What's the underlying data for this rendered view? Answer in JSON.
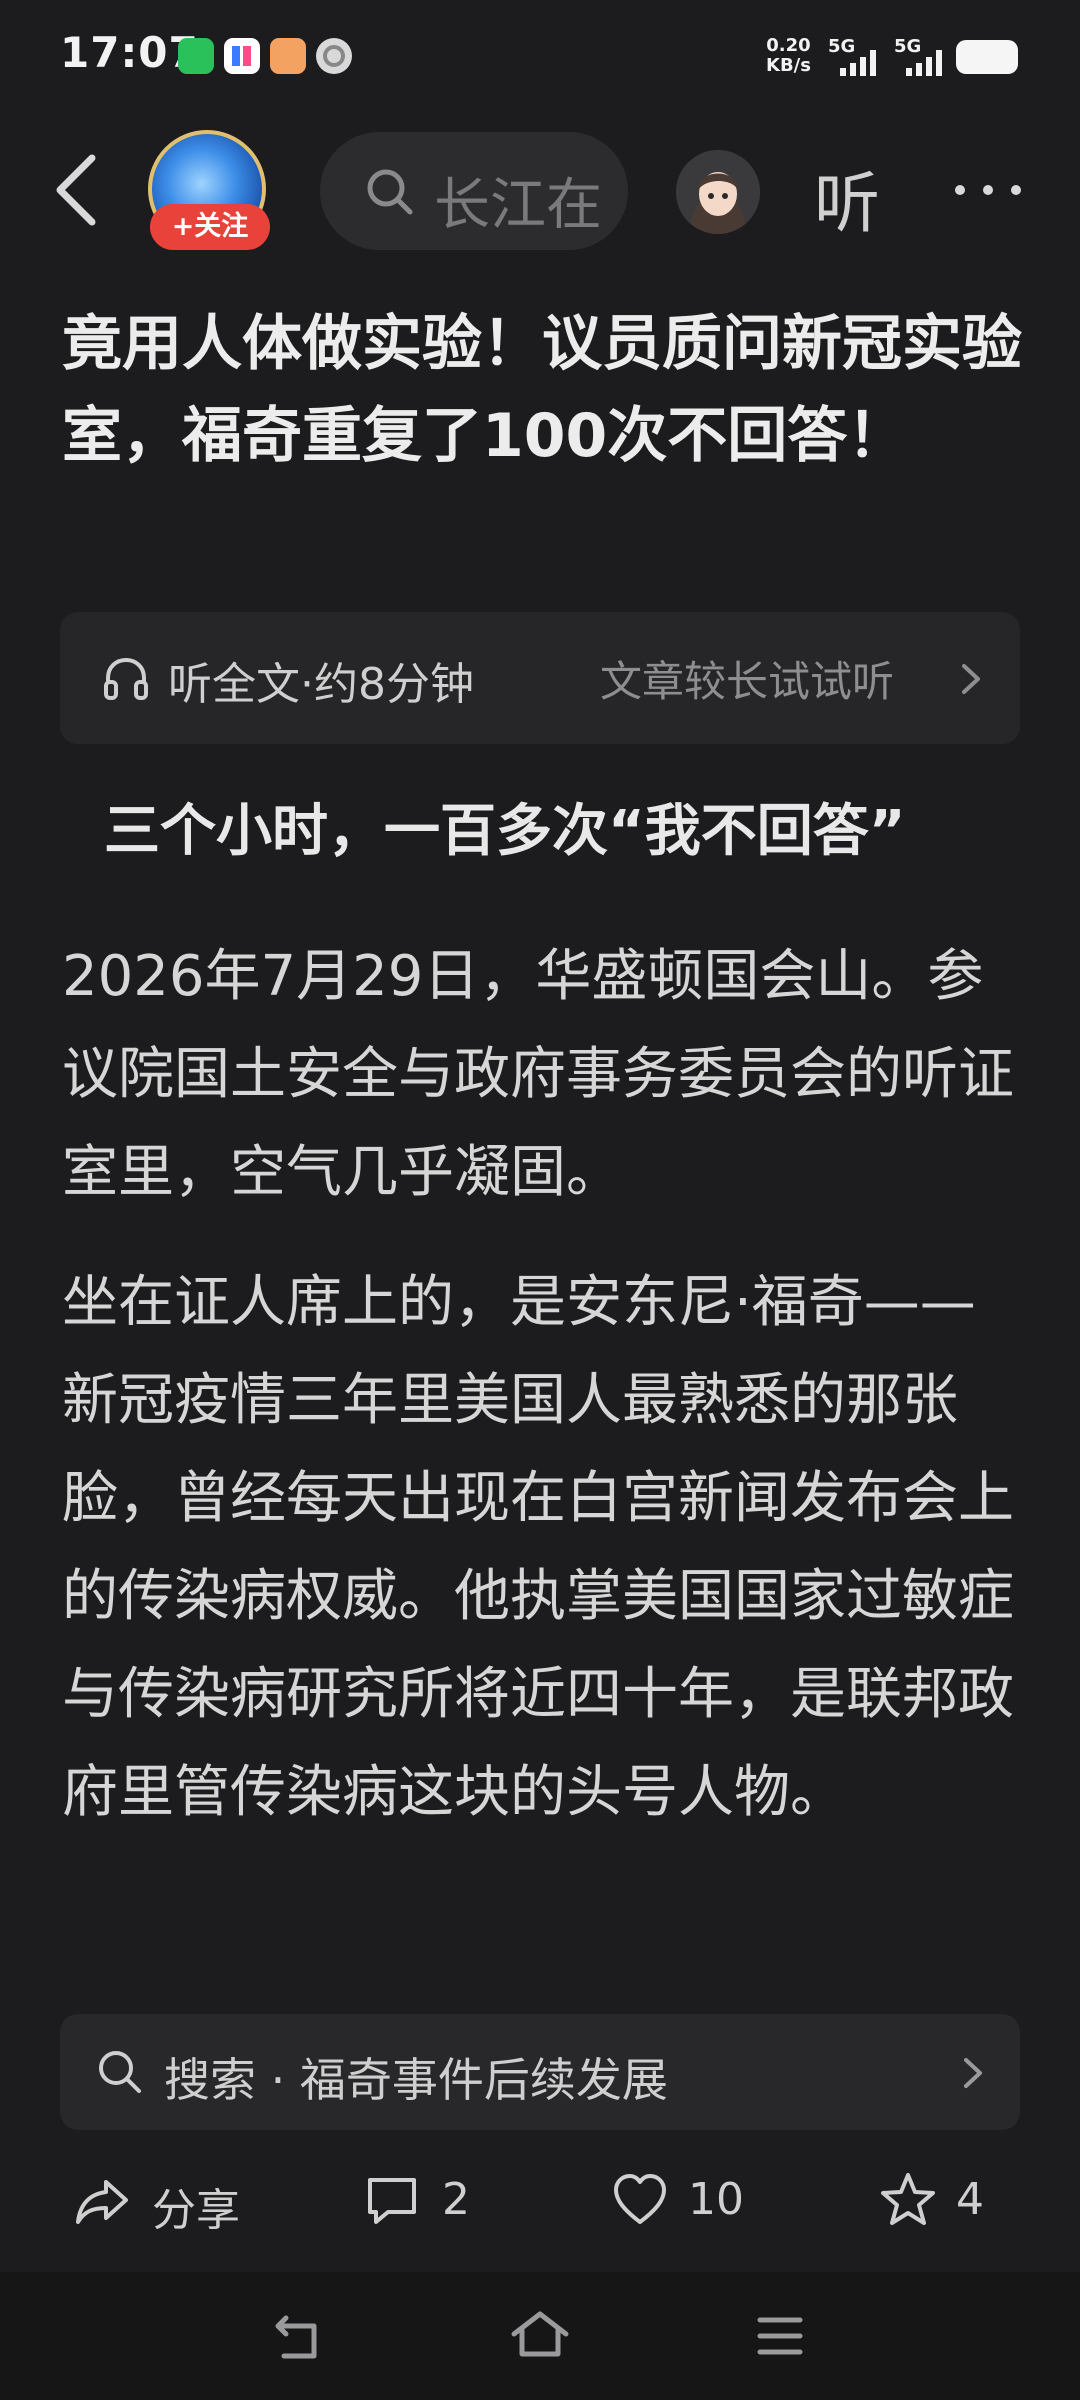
{
  "status_bar": {
    "time": "17:07",
    "apps": [
      "wechat-app-icon",
      "kwai-app-icon",
      "douyin-app-icon",
      "settings-app-icon"
    ],
    "net_speed_value": "0.20",
    "net_speed_unit": "KB/s",
    "signal_1_label": "5G",
    "signal_2_label": "5G"
  },
  "nav": {
    "follow_label": "+关注",
    "search_placeholder": "长江在",
    "listen_label": "听"
  },
  "article": {
    "title": "竟用人体做实验！议员质问新冠实验室，福奇重复了100次不回答！",
    "listen_bar": {
      "left_text": "听全文·约8分钟",
      "right_text": "文章较长试试听"
    },
    "subheading": "三个小时，一百多次“我不回答”",
    "paragraphs": [
      "2026年7月29日，华盛顿国会山。参议院国土安全与政府事务委员会的听证室里，空气几乎凝固。",
      "坐在证人席上的，是安东尼·福奇——新冠疫情三年里美国人最熟悉的那张脸，曾经每天出现在白宫新闻发布会上的传染病权威。他执掌美国国家过敏症与传染病研究所将近四十年，是联邦政府里管传染病这块的头号人物。"
    ]
  },
  "search_suggestion": {
    "text": "搜索 · 福奇事件后续发展"
  },
  "actions": {
    "share_label": "分享",
    "comment_count": "2",
    "like_count": "10",
    "favorite_count": "4"
  },
  "colors": {
    "background": "#1c1c1e",
    "follow_badge": "#e9423a",
    "card": "#262628"
  }
}
